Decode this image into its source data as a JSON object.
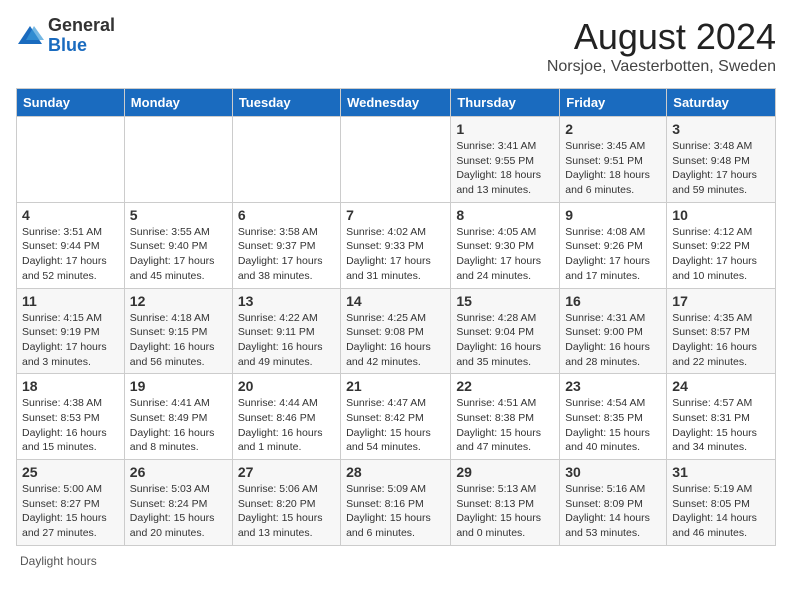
{
  "header": {
    "logo_general": "General",
    "logo_blue": "Blue",
    "month_title": "August 2024",
    "location": "Norsjoe, Vaesterbotten, Sweden"
  },
  "days_of_week": [
    "Sunday",
    "Monday",
    "Tuesday",
    "Wednesday",
    "Thursday",
    "Friday",
    "Saturday"
  ],
  "weeks": [
    [
      {
        "day": "",
        "info": ""
      },
      {
        "day": "",
        "info": ""
      },
      {
        "day": "",
        "info": ""
      },
      {
        "day": "",
        "info": ""
      },
      {
        "day": "1",
        "info": "Sunrise: 3:41 AM\nSunset: 9:55 PM\nDaylight: 18 hours\nand 13 minutes."
      },
      {
        "day": "2",
        "info": "Sunrise: 3:45 AM\nSunset: 9:51 PM\nDaylight: 18 hours\nand 6 minutes."
      },
      {
        "day": "3",
        "info": "Sunrise: 3:48 AM\nSunset: 9:48 PM\nDaylight: 17 hours\nand 59 minutes."
      }
    ],
    [
      {
        "day": "4",
        "info": "Sunrise: 3:51 AM\nSunset: 9:44 PM\nDaylight: 17 hours\nand 52 minutes."
      },
      {
        "day": "5",
        "info": "Sunrise: 3:55 AM\nSunset: 9:40 PM\nDaylight: 17 hours\nand 45 minutes."
      },
      {
        "day": "6",
        "info": "Sunrise: 3:58 AM\nSunset: 9:37 PM\nDaylight: 17 hours\nand 38 minutes."
      },
      {
        "day": "7",
        "info": "Sunrise: 4:02 AM\nSunset: 9:33 PM\nDaylight: 17 hours\nand 31 minutes."
      },
      {
        "day": "8",
        "info": "Sunrise: 4:05 AM\nSunset: 9:30 PM\nDaylight: 17 hours\nand 24 minutes."
      },
      {
        "day": "9",
        "info": "Sunrise: 4:08 AM\nSunset: 9:26 PM\nDaylight: 17 hours\nand 17 minutes."
      },
      {
        "day": "10",
        "info": "Sunrise: 4:12 AM\nSunset: 9:22 PM\nDaylight: 17 hours\nand 10 minutes."
      }
    ],
    [
      {
        "day": "11",
        "info": "Sunrise: 4:15 AM\nSunset: 9:19 PM\nDaylight: 17 hours\nand 3 minutes."
      },
      {
        "day": "12",
        "info": "Sunrise: 4:18 AM\nSunset: 9:15 PM\nDaylight: 16 hours\nand 56 minutes."
      },
      {
        "day": "13",
        "info": "Sunrise: 4:22 AM\nSunset: 9:11 PM\nDaylight: 16 hours\nand 49 minutes."
      },
      {
        "day": "14",
        "info": "Sunrise: 4:25 AM\nSunset: 9:08 PM\nDaylight: 16 hours\nand 42 minutes."
      },
      {
        "day": "15",
        "info": "Sunrise: 4:28 AM\nSunset: 9:04 PM\nDaylight: 16 hours\nand 35 minutes."
      },
      {
        "day": "16",
        "info": "Sunrise: 4:31 AM\nSunset: 9:00 PM\nDaylight: 16 hours\nand 28 minutes."
      },
      {
        "day": "17",
        "info": "Sunrise: 4:35 AM\nSunset: 8:57 PM\nDaylight: 16 hours\nand 22 minutes."
      }
    ],
    [
      {
        "day": "18",
        "info": "Sunrise: 4:38 AM\nSunset: 8:53 PM\nDaylight: 16 hours\nand 15 minutes."
      },
      {
        "day": "19",
        "info": "Sunrise: 4:41 AM\nSunset: 8:49 PM\nDaylight: 16 hours\nand 8 minutes."
      },
      {
        "day": "20",
        "info": "Sunrise: 4:44 AM\nSunset: 8:46 PM\nDaylight: 16 hours\nand 1 minute."
      },
      {
        "day": "21",
        "info": "Sunrise: 4:47 AM\nSunset: 8:42 PM\nDaylight: 15 hours\nand 54 minutes."
      },
      {
        "day": "22",
        "info": "Sunrise: 4:51 AM\nSunset: 8:38 PM\nDaylight: 15 hours\nand 47 minutes."
      },
      {
        "day": "23",
        "info": "Sunrise: 4:54 AM\nSunset: 8:35 PM\nDaylight: 15 hours\nand 40 minutes."
      },
      {
        "day": "24",
        "info": "Sunrise: 4:57 AM\nSunset: 8:31 PM\nDaylight: 15 hours\nand 34 minutes."
      }
    ],
    [
      {
        "day": "25",
        "info": "Sunrise: 5:00 AM\nSunset: 8:27 PM\nDaylight: 15 hours\nand 27 minutes."
      },
      {
        "day": "26",
        "info": "Sunrise: 5:03 AM\nSunset: 8:24 PM\nDaylight: 15 hours\nand 20 minutes."
      },
      {
        "day": "27",
        "info": "Sunrise: 5:06 AM\nSunset: 8:20 PM\nDaylight: 15 hours\nand 13 minutes."
      },
      {
        "day": "28",
        "info": "Sunrise: 5:09 AM\nSunset: 8:16 PM\nDaylight: 15 hours\nand 6 minutes."
      },
      {
        "day": "29",
        "info": "Sunrise: 5:13 AM\nSunset: 8:13 PM\nDaylight: 15 hours\nand 0 minutes."
      },
      {
        "day": "30",
        "info": "Sunrise: 5:16 AM\nSunset: 8:09 PM\nDaylight: 14 hours\nand 53 minutes."
      },
      {
        "day": "31",
        "info": "Sunrise: 5:19 AM\nSunset: 8:05 PM\nDaylight: 14 hours\nand 46 minutes."
      }
    ]
  ],
  "footer": {
    "daylight_label": "Daylight hours"
  }
}
